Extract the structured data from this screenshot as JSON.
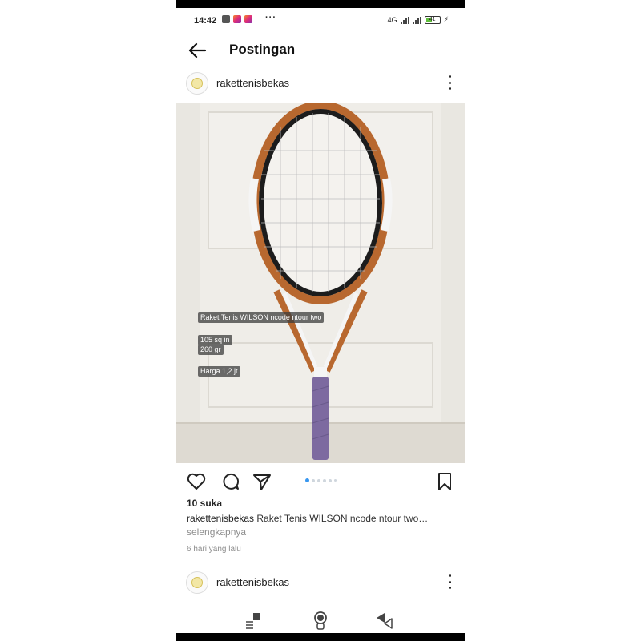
{
  "status_bar": {
    "time": "14:42",
    "more": "···",
    "battery": "41",
    "network_label": "4G"
  },
  "app_bar": {
    "title": "Postingan",
    "back_icon": "arrow-left-icon"
  },
  "post": {
    "username": "rakettenisbekas",
    "image_overlay": {
      "line1": "Raket Tenis WILSON ncode ntour two",
      "line2": "105 sq in",
      "line3": "260 gr",
      "line4": "Harga 1,2 jt"
    },
    "likes": "10 suka",
    "caption_username": "rakettenisbekas",
    "caption_text": "Raket Tenis WILSON ncode ntour two…",
    "more_label": "selengkapnya",
    "time_ago": "6 hari yang lalu",
    "carousel": {
      "count": 6,
      "active_index": 0
    }
  },
  "next_post": {
    "username": "rakettenisbekas"
  },
  "colors": {
    "accent_blue": "#3897f0",
    "racket_orange": "#b8682f",
    "racket_grip": "#7d6aa0"
  }
}
